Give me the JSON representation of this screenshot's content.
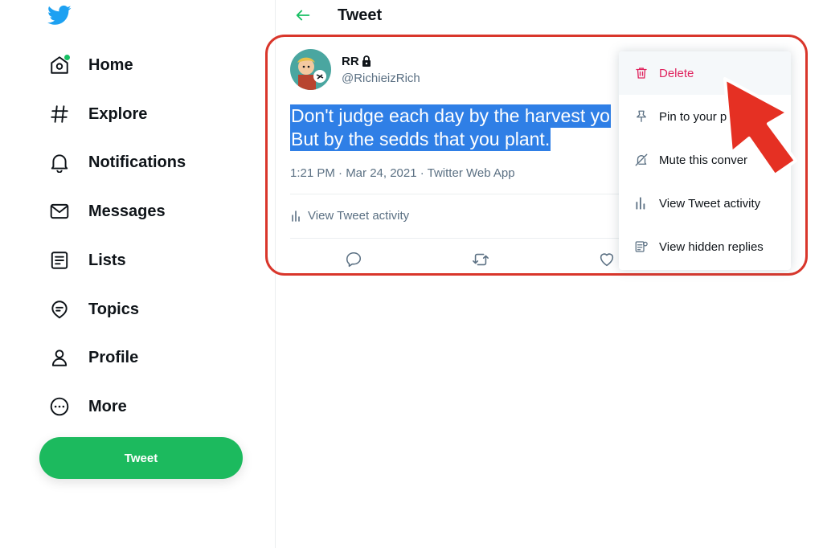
{
  "sidebar": {
    "items": [
      {
        "label": "Home",
        "icon": "home-icon"
      },
      {
        "label": "Explore",
        "icon": "hashtag-icon"
      },
      {
        "label": "Notifications",
        "icon": "bell-icon"
      },
      {
        "label": "Messages",
        "icon": "envelope-icon"
      },
      {
        "label": "Lists",
        "icon": "list-icon"
      },
      {
        "label": "Topics",
        "icon": "topics-icon"
      },
      {
        "label": "Profile",
        "icon": "person-icon"
      },
      {
        "label": "More",
        "icon": "more-icon"
      }
    ],
    "tweet_button": "Tweet"
  },
  "header": {
    "title": "Tweet"
  },
  "tweet": {
    "display_name": "RR",
    "handle": "@RichieizRich",
    "text_line1": "Don't judge each day by the harvest yo",
    "text_line2": "But by the sedds that you plant.",
    "meta": "1:21 PM · Mar 24, 2021 · Twitter Web App",
    "activity": "View Tweet activity"
  },
  "menu": {
    "items": [
      {
        "label": "Delete",
        "icon": "trash-icon"
      },
      {
        "label": "Pin to your p",
        "icon": "pin-icon"
      },
      {
        "label": "Mute this conver",
        "icon": "mute-icon"
      },
      {
        "label": "View Tweet activity",
        "icon": "activity-icon"
      },
      {
        "label": "View hidden replies",
        "icon": "hidden-replies-icon"
      }
    ]
  },
  "colors": {
    "accent_green": "#1cba5e",
    "delete_red": "#e0245e",
    "highlight_blue": "#2f7fe6",
    "annotation_red": "#d9362b"
  }
}
